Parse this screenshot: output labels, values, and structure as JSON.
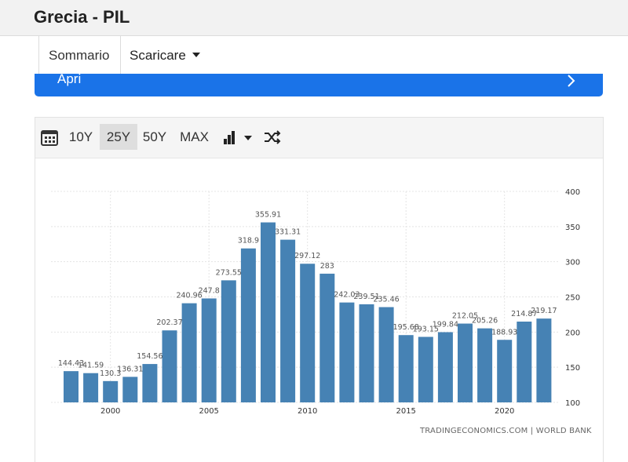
{
  "header": {
    "title": "Grecia - PIL"
  },
  "tabs": {
    "summary_label": "Sommario",
    "download_label": "Scaricare"
  },
  "banner": {
    "label": "Apri"
  },
  "toolbar": {
    "range_10y": "10Y",
    "range_25y": "25Y",
    "range_50y": "50Y",
    "range_max": "MAX",
    "active_range": "25Y"
  },
  "chart_data": {
    "type": "bar",
    "color": "#4682b4",
    "x": [
      1998,
      1999,
      2000,
      2001,
      2002,
      2003,
      2004,
      2005,
      2006,
      2007,
      2008,
      2009,
      2010,
      2011,
      2012,
      2013,
      2014,
      2015,
      2016,
      2017,
      2018,
      2019,
      2020,
      2021,
      2022
    ],
    "values": [
      144.43,
      141.59,
      130.3,
      136.31,
      154.56,
      202.37,
      240.96,
      247.8,
      273.55,
      318.9,
      355.91,
      331.31,
      297.12,
      283,
      242.03,
      239.51,
      235.46,
      195.68,
      193.15,
      199.84,
      212.05,
      205.26,
      188.93,
      214.87,
      219.17
    ],
    "labels": [
      "144.43",
      "141.59",
      "130.3",
      "136.31",
      "154.56",
      "202.37",
      "240.96",
      "247.8",
      "273.55",
      "318.9",
      "355.91",
      "331.31",
      "297.12",
      "283",
      "242.03",
      "239.51",
      "235.46",
      "195.68",
      "193.15",
      "199.84",
      "212.05",
      "205.26",
      "188.93",
      "214.87",
      "219.17"
    ],
    "xticks": [
      "2000",
      "2005",
      "2010",
      "2015",
      "2020"
    ],
    "yticks": [
      "100",
      "150",
      "200",
      "250",
      "300",
      "350",
      "400"
    ],
    "ylim": [
      100,
      400
    ],
    "grid": true,
    "source": "TRADINGECONOMICS.COM | WORLD BANK"
  }
}
